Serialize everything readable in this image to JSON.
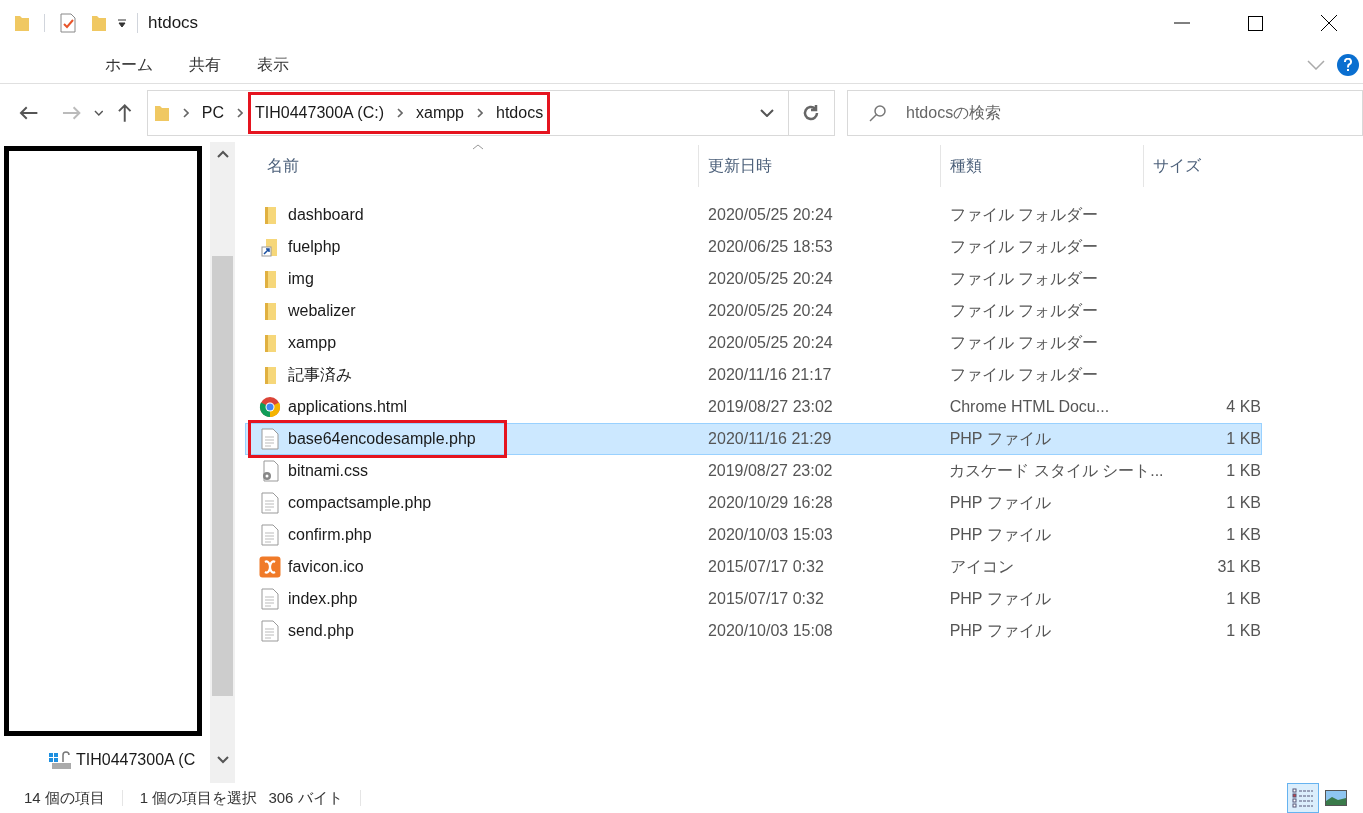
{
  "window": {
    "title": "htdocs"
  },
  "ribbon_tabs": [
    "ホーム",
    "共有",
    "表示"
  ],
  "address": {
    "crumbs": [
      {
        "label": "PC",
        "highlighted": false
      },
      {
        "label": "TIH0447300A (C:)",
        "highlighted": true
      },
      {
        "label": "xampp",
        "highlighted": true
      },
      {
        "label": "htdocs",
        "highlighted": true
      }
    ]
  },
  "search": {
    "placeholder": "htdocsの検索"
  },
  "nav_pane": {
    "items": [
      {
        "label": "TIH0447300A (C"
      }
    ]
  },
  "columns": [
    "名前",
    "更新日時",
    "種類",
    "サイズ"
  ],
  "rows": [
    {
      "kind": "folder",
      "name": "dashboard",
      "date": "2020/05/25 20:24",
      "type": "ファイル フォルダー",
      "selected": false
    },
    {
      "kind": "shortcut",
      "name": "fuelphp",
      "date": "2020/06/25 18:53",
      "type": "ファイル フォルダー",
      "selected": false
    },
    {
      "kind": "folder",
      "name": "img",
      "date": "2020/05/25 20:24",
      "type": "ファイル フォルダー",
      "selected": false
    },
    {
      "kind": "folder",
      "name": "webalizer",
      "date": "2020/05/25 20:24",
      "type": "ファイル フォルダー",
      "selected": false
    },
    {
      "kind": "folder",
      "name": "xampp",
      "date": "2020/05/25 20:24",
      "type": "ファイル フォルダー",
      "selected": false
    },
    {
      "kind": "folder",
      "name": "記事済み",
      "date": "2020/11/16 21:17",
      "type": "ファイル フォルダー",
      "selected": false
    },
    {
      "kind": "chrome",
      "name": "applications.html",
      "date": "2019/08/27 23:02",
      "type": "Chrome HTML Docu...",
      "size": "4 KB",
      "selected": false
    },
    {
      "kind": "document",
      "name": "base64encodesample.php",
      "date": "2020/11/16 21:29",
      "type": "PHP ファイル",
      "size": "1 KB",
      "selected": true
    },
    {
      "kind": "stylesheet",
      "name": "bitnami.css",
      "date": "2019/08/27 23:02",
      "type": "カスケード スタイル シート...",
      "size": "1 KB",
      "selected": false
    },
    {
      "kind": "document",
      "name": "compactsample.php",
      "date": "2020/10/29 16:28",
      "type": "PHP ファイル",
      "size": "1 KB",
      "selected": false
    },
    {
      "kind": "document",
      "name": "confirm.php",
      "date": "2020/10/03 15:03",
      "type": "PHP ファイル",
      "size": "1 KB",
      "selected": false
    },
    {
      "kind": "xampp",
      "name": "favicon.ico",
      "date": "2015/07/17 0:32",
      "type": "アイコン",
      "size": "31 KB",
      "selected": false
    },
    {
      "kind": "document",
      "name": "index.php",
      "date": "2015/07/17 0:32",
      "type": "PHP ファイル",
      "size": "1 KB",
      "selected": false
    },
    {
      "kind": "document",
      "name": "send.php",
      "date": "2020/10/03 15:08",
      "type": "PHP ファイル",
      "size": "1 KB",
      "selected": false
    }
  ],
  "status_bar": {
    "item_count": "14 個の項目",
    "selection": "1 個の項目を選択",
    "selection_size": "306 バイト"
  }
}
